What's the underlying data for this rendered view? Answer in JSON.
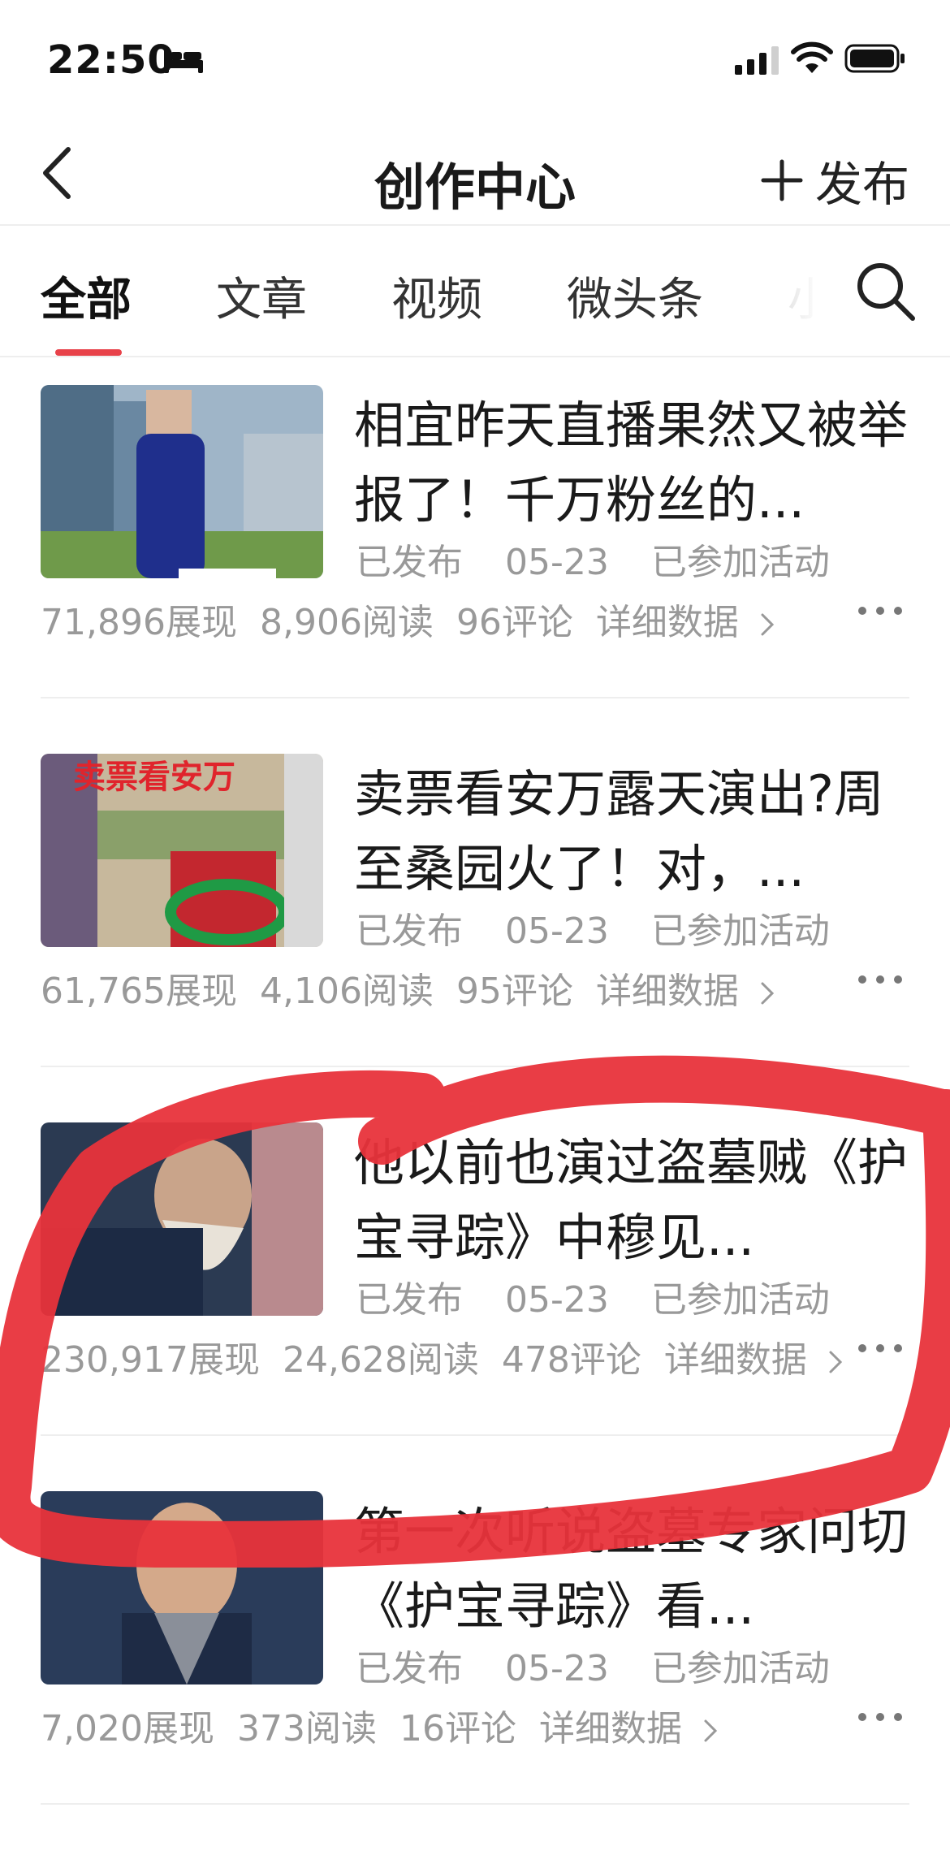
{
  "status_bar": {
    "time": "22:50"
  },
  "nav": {
    "title": "创作中心",
    "publish_label": "发布"
  },
  "tabs": [
    {
      "label": "全部",
      "active": true
    },
    {
      "label": "文章",
      "active": false
    },
    {
      "label": "视频",
      "active": false
    },
    {
      "label": "微头条",
      "active": false
    },
    {
      "label": "小",
      "active": false
    }
  ],
  "articles": [
    {
      "title": "相宜昨天直播果然又被举报了！千万粉丝的...",
      "status": "已发布",
      "date": "05-23",
      "activity": "已参加活动",
      "impressions": "71,896展现",
      "reads": "8,906阅读",
      "comments": "96评论",
      "detail": "详细数据"
    },
    {
      "title": "卖票看安万露天演出?周至桑园火了！对，...",
      "status": "已发布",
      "date": "05-23",
      "activity": "已参加活动",
      "impressions": "61,765展现",
      "reads": "4,106阅读",
      "comments": "95评论",
      "detail": "详细数据",
      "thumb_text": "卖票看安万"
    },
    {
      "title": "他以前也演过盗墓贼《护宝寻踪》中穆见...",
      "status": "已发布",
      "date": "05-23",
      "activity": "已参加活动",
      "impressions": "230,917展现",
      "reads": "24,628阅读",
      "comments": "478评论",
      "detail": "详细数据"
    },
    {
      "title": "第一次听说盗墓专家问切《护宝寻踪》看...",
      "status": "已发布",
      "date": "05-23",
      "activity": "已参加活动",
      "impressions": "7,020展现",
      "reads": "373阅读",
      "comments": "16评论",
      "detail": "详细数据"
    }
  ],
  "colors": {
    "accent": "#e8424a",
    "annotation": "#e8333b",
    "meta_text": "#999999"
  }
}
